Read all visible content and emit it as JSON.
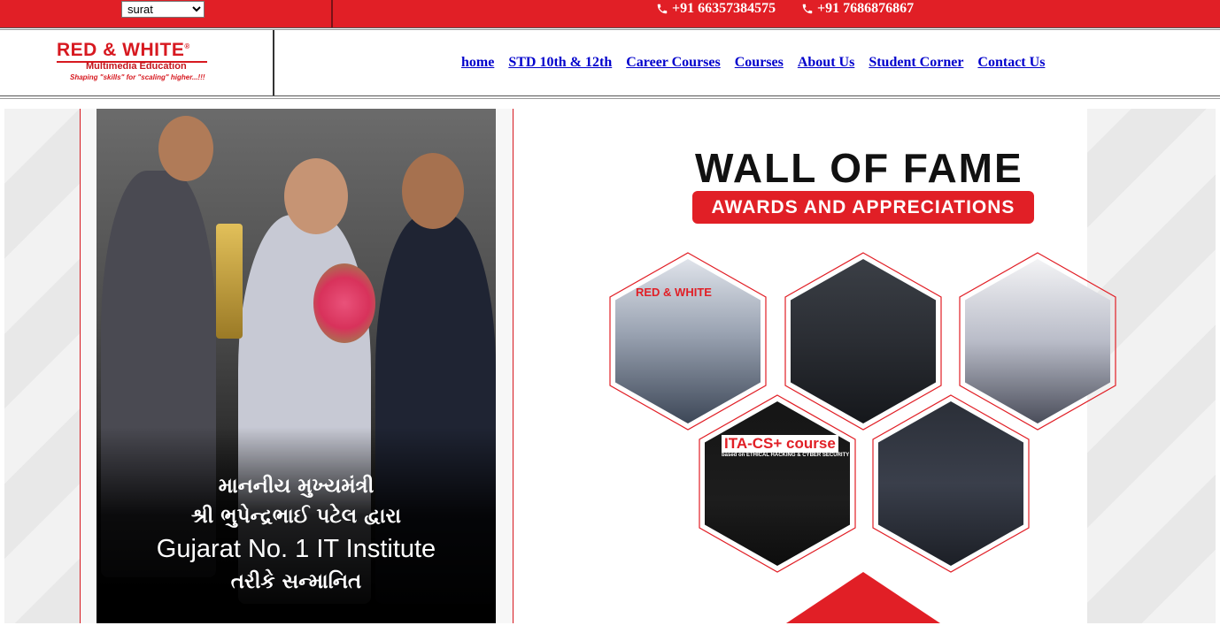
{
  "topbar": {
    "city_selected": "surat",
    "phones": [
      "+91 66357384575",
      "+91 7686876867"
    ]
  },
  "logo": {
    "name": "RED & WHITE",
    "reg": "®",
    "subtitle": "Multimedia Education",
    "tagline": "Shaping \"skills\" for \"scaling\" higher...!!!"
  },
  "nav": {
    "items": [
      "home",
      "STD 10th & 12th",
      "Career Courses",
      "Courses",
      "About Us",
      "Student Corner",
      "Contact Us"
    ]
  },
  "banner": {
    "caption_lines": [
      "માનનીય મુખ્યમંત્રી",
      "શ્રી ભુપેન્દ્રભાઈ પટેલ દ્વારા",
      "Gujarat No. 1 IT Institute",
      "તરીકે સન્માનિત"
    ],
    "title": "WALL OF FAME",
    "subtitle": "AWARDS AND APPRECIATIONS",
    "hex_texts": {
      "ita": "ITA-CS+ course",
      "ita_sub": "based on ETHICAL HACKING & CYBER SECURITY",
      "rw": "RED & WHITE"
    }
  },
  "colors": {
    "brand_red": "#e11f26",
    "link_blue": "#0000cc"
  }
}
